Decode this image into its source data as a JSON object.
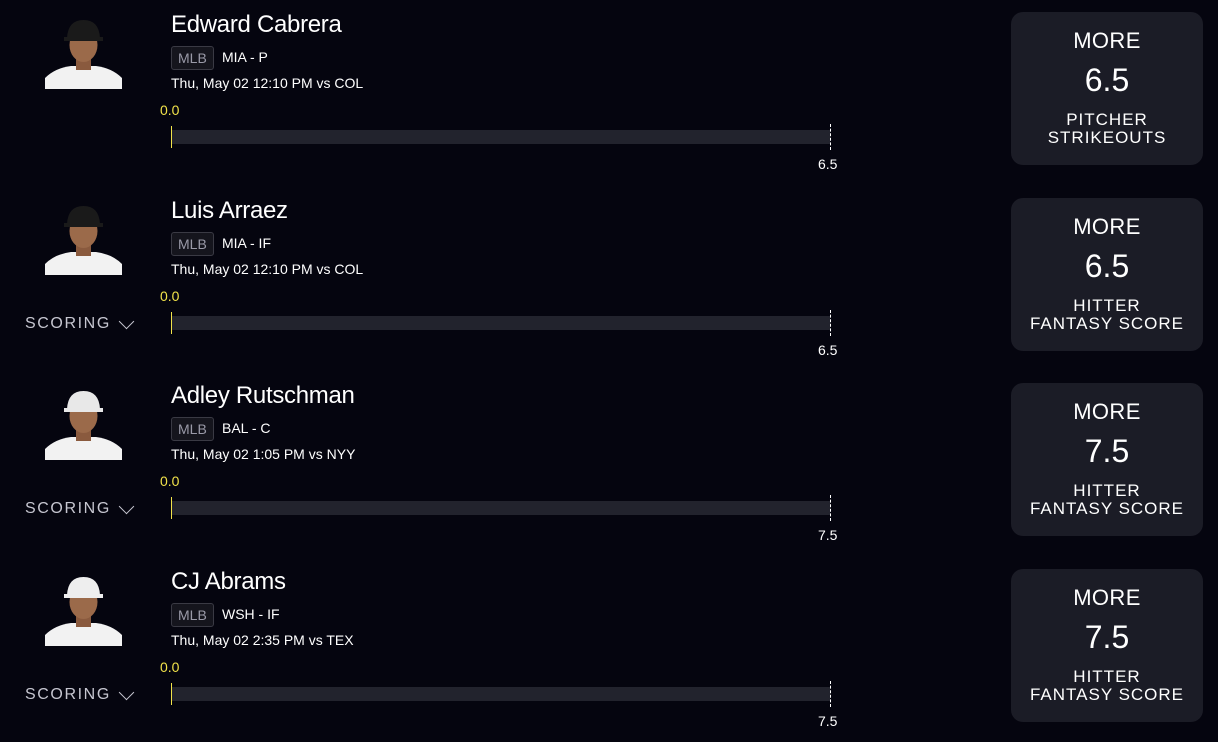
{
  "colors": {
    "background": "#05050f",
    "card": "#1b1c26",
    "track": "#22232d",
    "accent_yellow": "#f2e34a",
    "muted_text": "#c6c6d0"
  },
  "picks": [
    {
      "player_name": "Edward Cabrera",
      "league": "MLB",
      "team_position": "MIA - P",
      "game_info": "Thu, May 02 12:10 PM  vs COL",
      "current_value": "0.0",
      "progress_fraction": 0,
      "line_value": "6.5",
      "has_scoring": false,
      "scoring_label": "",
      "avatar_icon": "player-headshot-icon",
      "cap_color": "#1a1a1a",
      "card": {
        "direction": "MORE",
        "line": "6.5",
        "stat_line1": "PITCHER",
        "stat_line2": "STRIKEOUTS"
      }
    },
    {
      "player_name": "Luis Arraez",
      "league": "MLB",
      "team_position": "MIA - IF",
      "game_info": "Thu, May 02 12:10 PM  vs COL",
      "current_value": "0.0",
      "progress_fraction": 0,
      "line_value": "6.5",
      "has_scoring": true,
      "scoring_label": "SCORING",
      "avatar_icon": "player-headshot-icon",
      "cap_color": "#1a1a1a",
      "card": {
        "direction": "MORE",
        "line": "6.5",
        "stat_line1": "HITTER",
        "stat_line2": "FANTASY SCORE"
      }
    },
    {
      "player_name": "Adley Rutschman",
      "league": "MLB",
      "team_position": "BAL - C",
      "game_info": "Thu, May 02 1:05 PM  vs NYY",
      "current_value": "0.0",
      "progress_fraction": 0,
      "line_value": "7.5",
      "has_scoring": true,
      "scoring_label": "SCORING",
      "avatar_icon": "player-headshot-icon",
      "cap_color": "#e8e8e8",
      "card": {
        "direction": "MORE",
        "line": "7.5",
        "stat_line1": "HITTER",
        "stat_line2": "FANTASY SCORE"
      }
    },
    {
      "player_name": "CJ Abrams",
      "league": "MLB",
      "team_position": "WSH - IF",
      "game_info": "Thu, May 02 2:35 PM  vs TEX",
      "current_value": "0.0",
      "progress_fraction": 0,
      "line_value": "7.5",
      "has_scoring": true,
      "scoring_label": "SCORING",
      "avatar_icon": "player-headshot-icon",
      "cap_color": "#eeeeee",
      "card": {
        "direction": "MORE",
        "line": "7.5",
        "stat_line1": "HITTER",
        "stat_line2": "FANTASY SCORE"
      }
    }
  ]
}
